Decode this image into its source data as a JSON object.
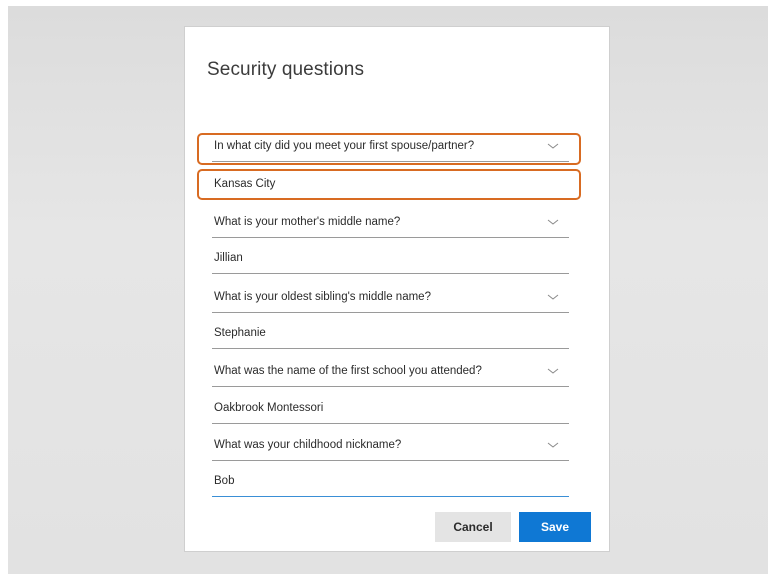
{
  "dialog": {
    "title": "Security questions"
  },
  "questions": [
    {
      "question": "In what city did you meet your first spouse/partner?",
      "answer": "Kansas City"
    },
    {
      "question": "What is your mother's middle name?",
      "answer": "Jillian"
    },
    {
      "question": "What is your oldest sibling's middle name?",
      "answer": "Stephanie"
    },
    {
      "question": "What was the name of the first school you attended?",
      "answer": "Oakbrook Montessori"
    },
    {
      "question": "What was your childhood nickname?",
      "answer": "Bob"
    }
  ],
  "buttons": {
    "cancel": "Cancel",
    "save": "Save"
  },
  "icons": {
    "dropdown": "chevron-down-icon"
  },
  "colors": {
    "highlight": "#d86b22",
    "accent": "#0f78d4",
    "focus_underline": "#3a8fd6"
  }
}
